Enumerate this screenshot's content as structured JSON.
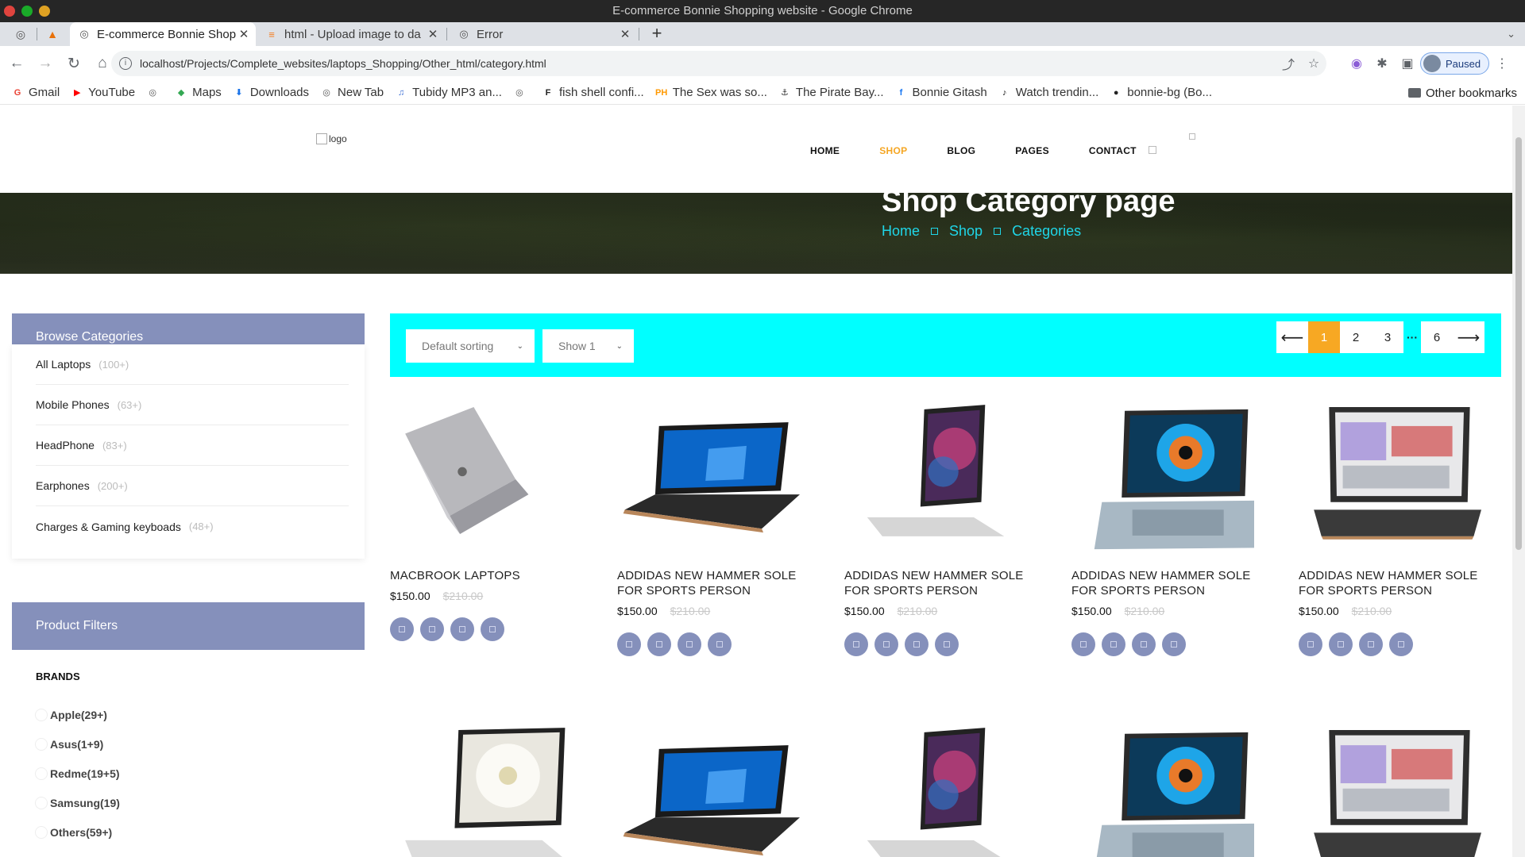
{
  "window": {
    "title": "E-commerce Bonnie Shopping website - Google Chrome"
  },
  "tabs": [
    {
      "label": "E-commerce Bonnie Shop",
      "active": true
    },
    {
      "label": "html - Upload image to da",
      "active": false
    },
    {
      "label": "Error",
      "active": false
    }
  ],
  "toolbar": {
    "url": "localhost/Projects/Complete_websites/laptops_Shopping/Other_html/category.html",
    "profile_label": "Paused"
  },
  "bookmarks": [
    {
      "label": "Gmail",
      "icon": "gmail-icon",
      "color": "#ea4335"
    },
    {
      "label": "YouTube",
      "icon": "youtube-icon",
      "color": "#ff0000"
    },
    {
      "label": "",
      "icon": "globe-icon",
      "color": "#555555"
    },
    {
      "label": "Maps",
      "icon": "maps-icon",
      "color": "#34a853"
    },
    {
      "label": "Downloads",
      "icon": "download-icon",
      "color": "#1a73e8"
    },
    {
      "label": "New Tab",
      "icon": "globe-icon",
      "color": "#555555"
    },
    {
      "label": "Tubidy MP3 an...",
      "icon": "tubidy-icon",
      "color": "#3b6fd6"
    },
    {
      "label": "",
      "icon": "globe-icon",
      "color": "#555555"
    },
    {
      "label": "fish shell confi...",
      "icon": "fish-icon",
      "color": "#222222"
    },
    {
      "label": "The Sex was so...",
      "icon": "ph-icon",
      "color": "#ff9900"
    },
    {
      "label": "The Pirate Bay...",
      "icon": "pirate-icon",
      "color": "#333333"
    },
    {
      "label": "Bonnie Gitash",
      "icon": "facebook-icon",
      "color": "#1877f2"
    },
    {
      "label": "Watch trendin...",
      "icon": "tiktok-icon",
      "color": "#111111"
    },
    {
      "label": "bonnie-bg (Bo...",
      "icon": "github-icon",
      "color": "#222222"
    }
  ],
  "other_bookmarks": "Other bookmarks",
  "site": {
    "logo_alt": "logo",
    "nav": [
      "HOME",
      "SHOP",
      "BLOG",
      "PAGES",
      "CONTACT"
    ],
    "nav_active": "SHOP",
    "banner_title": "Shop Category page",
    "breadcrumb": [
      "Home",
      "Shop",
      "Categories"
    ]
  },
  "sidebar": {
    "categories_title": "Browse Categories",
    "categories": [
      {
        "label": "All Laptops",
        "count": "(100+)"
      },
      {
        "label": "Mobile Phones",
        "count": "(63+)"
      },
      {
        "label": "HeadPhone",
        "count": "(83+)"
      },
      {
        "label": "Earphones",
        "count": "(200+)"
      },
      {
        "label": "Charges & Gaming keyboads",
        "count": "(48+)"
      }
    ],
    "filters_title": "Product Filters",
    "brands_title": "BRANDS",
    "brands": [
      "Apple(29+)",
      "Asus(1+9)",
      "Redme(19+5)",
      "Samsung(19)",
      "Others(59+)"
    ]
  },
  "shop": {
    "sort_label": "Default sorting",
    "show_label": "Show 1",
    "pages": [
      "1",
      "2",
      "3",
      "6"
    ],
    "current_page": "1",
    "accent": "#00ffff",
    "products": [
      {
        "name": "MACBROOK LAPTOPS",
        "price": "$150.00",
        "old_price": "$210.00"
      },
      {
        "name": "ADDIDAS NEW HAMMER SOLE FOR SPORTS PERSON",
        "price": "$150.00",
        "old_price": "$210.00"
      },
      {
        "name": "ADDIDAS NEW HAMMER SOLE FOR SPORTS PERSON",
        "price": "$150.00",
        "old_price": "$210.00"
      },
      {
        "name": "ADDIDAS NEW HAMMER SOLE FOR SPORTS PERSON",
        "price": "$150.00",
        "old_price": "$210.00"
      },
      {
        "name": "ADDIDAS NEW HAMMER SOLE FOR SPORTS PERSON",
        "price": "$150.00",
        "old_price": "$210.00"
      }
    ]
  }
}
